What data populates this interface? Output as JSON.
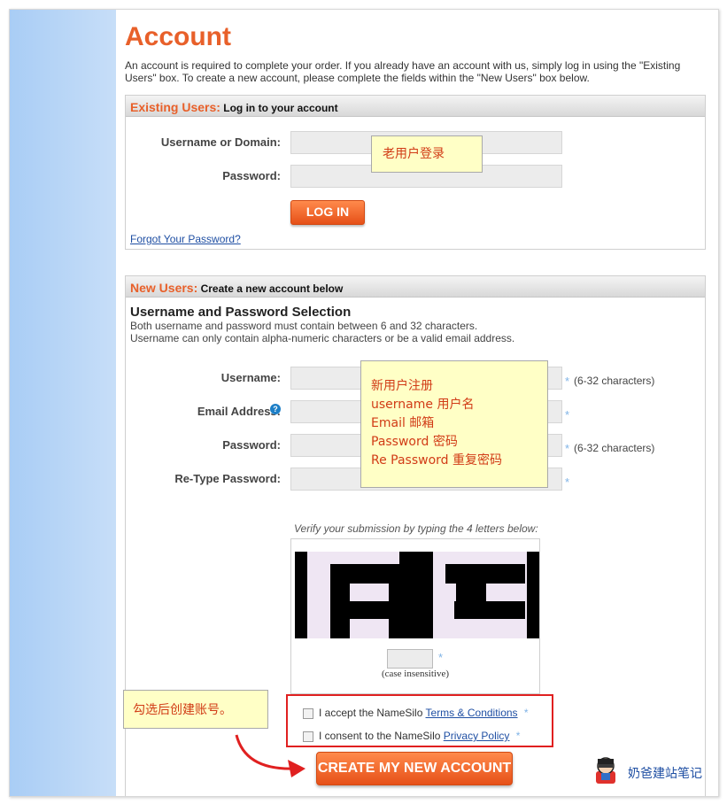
{
  "header": {
    "title": "Account",
    "intro": "An account is required to complete your order. If you already have an account with us, simply log in using the \"Existing Users\" box. To create a new account, please complete the fields within the \"New Users\" box below."
  },
  "existing": {
    "head_accent": "Existing Users:",
    "head_text": " Log in to your account",
    "username_label": "Username or Domain:",
    "password_label": "Password:",
    "login_button": "LOG IN",
    "forgot_link": "Forgot Your Password?",
    "note": "老用户登录"
  },
  "new_users": {
    "head_accent": "New Users:",
    "head_text": " Create a new account below",
    "section_title": "Username and Password Selection",
    "section_sub_1": "Both username and password must contain between 6 and 32 characters.",
    "section_sub_2": "Username can only contain alpha-numeric characters or be a valid email address.",
    "username_label": "Username:",
    "email_label": "Email Address:",
    "password_label": "Password:",
    "retype_label": "Re-Type Password:",
    "hint_6_32": "(6-32 characters)",
    "star": "*",
    "note_lines": [
      "新用户注册",
      "username  用户名",
      "Email 邮箱",
      "Password 密码",
      "Re Password 重复密码"
    ],
    "captcha_prompt": "Verify your submission by typing the 4 letters below:",
    "captcha_case": "(case insensitive)",
    "accept_prefix": "I accept the NameSilo ",
    "terms_link": "Terms & Conditions",
    "consent_prefix": "I consent to the NameSilo ",
    "privacy_link": "Privacy Policy",
    "check_note": "勾选后创建账号。",
    "create_button": "CREATE MY NEW ACCOUNT"
  },
  "watermark": {
    "text": "奶爸建站笔记"
  },
  "colors": {
    "accent": "#e8602a",
    "note_bg": "#ffffc6",
    "note_text": "#d13b16",
    "highlight_border": "#e02020"
  }
}
